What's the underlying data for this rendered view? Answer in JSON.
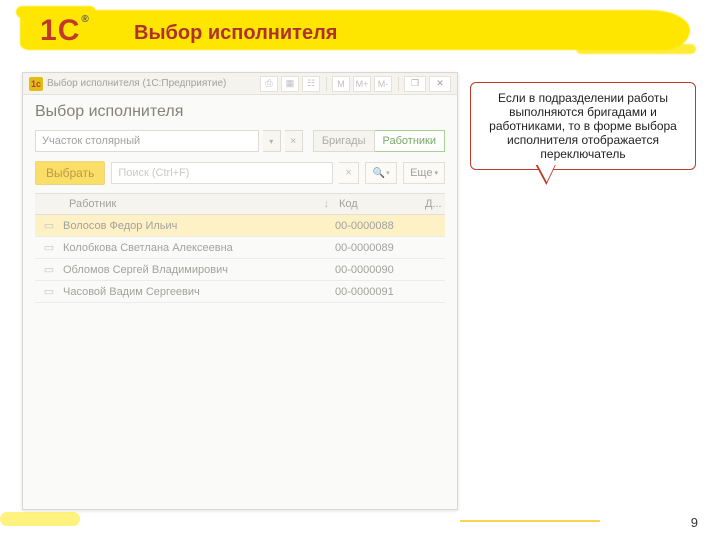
{
  "slide": {
    "title": "Выбор исполнителя",
    "page_number": "9"
  },
  "callout": {
    "text": "Если в подразделении работы выполняются бригадами и работниками, то в форме выбора исполнителя отображается переключатель"
  },
  "window": {
    "logo_text": "1C",
    "title": "Выбор исполнителя  (1С:Предприятие)",
    "tool_m": "M",
    "tool_mp": "M+",
    "tool_mm": "M-",
    "close": "✕"
  },
  "form": {
    "title": "Выбор исполнителя",
    "unit_value": "Участок столярный",
    "seg_brigades": "Бригады",
    "seg_workers": "Работники",
    "select_btn": "Выбрать",
    "search_placeholder": "Поиск (Ctrl+F)",
    "more_btn": "Еще"
  },
  "grid": {
    "col_name": "Работник",
    "col_code": "Код",
    "col_d": "Д...",
    "rows": [
      {
        "name": "Волосов Федор Ильич",
        "code": "00-0000088"
      },
      {
        "name": "Колобкова Светлана Алексеевна",
        "code": "00-0000089"
      },
      {
        "name": "Обломов Сергей Владимирович",
        "code": "00-0000090"
      },
      {
        "name": "Часовой Вадим Сергеевич",
        "code": "00-0000091"
      }
    ]
  }
}
